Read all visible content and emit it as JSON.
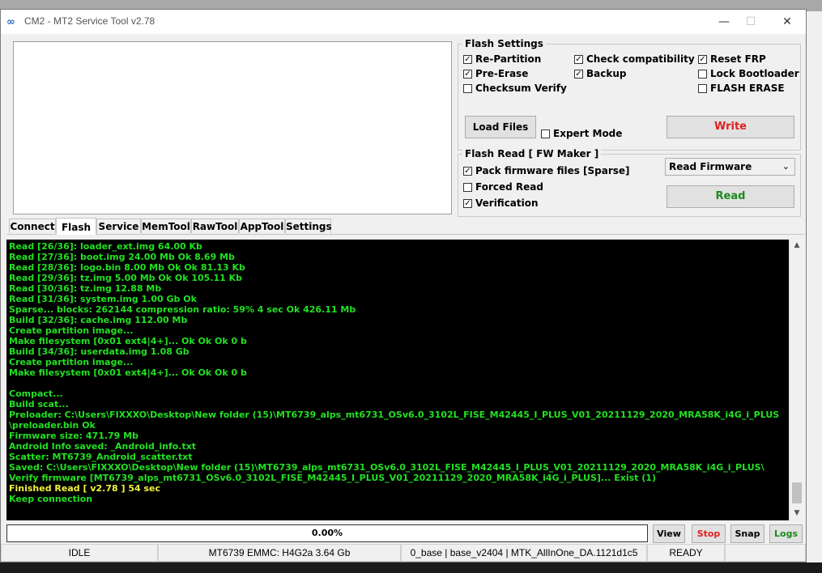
{
  "window": {
    "title": "CM2 - MT2 Service Tool v2.78",
    "icon": "mt2-app-icon",
    "controls": [
      "—",
      "☐",
      "✕"
    ]
  },
  "flash_settings": {
    "legend": "Flash Settings",
    "options": [
      {
        "label": "Re-Partition",
        "checked": true
      },
      {
        "label": "Check compatibility",
        "checked": true
      },
      {
        "label": "Reset FRP",
        "checked": true
      },
      {
        "label": "Pre-Erase",
        "checked": true
      },
      {
        "label": "Backup",
        "checked": true
      },
      {
        "label": "Lock Bootloader",
        "checked": false
      },
      {
        "label": "Checksum Verify",
        "checked": false
      },
      {
        "label": "FLASH ERASE",
        "checked": false
      }
    ],
    "load_files": "Load Files",
    "expert_mode": {
      "label": "Expert Mode",
      "checked": false
    },
    "write": "Write"
  },
  "flash_read": {
    "legend": "Flash Read [ FW Maker ]",
    "options": [
      {
        "label": "Pack firmware files [Sparse]",
        "checked": true
      },
      {
        "label": "Forced Read",
        "checked": false
      },
      {
        "label": "Verification",
        "checked": true
      }
    ],
    "mode_select": "Read Firmware",
    "read": "Read"
  },
  "tabs": [
    {
      "label": "Connect",
      "active": false
    },
    {
      "label": "Flash",
      "active": true
    },
    {
      "label": "Service",
      "active": false
    },
    {
      "label": "MemTool",
      "active": false
    },
    {
      "label": "RawTool",
      "active": false
    },
    {
      "label": "AppTool",
      "active": false
    },
    {
      "label": "Settings",
      "active": false
    }
  ],
  "log_lines": [
    "Read [26/36]: loader_ext.img 64.00 Kb",
    "Read [27/36]: boot.img 24.00 Mb Ok 8.69 Mb",
    "Read [28/36]: logo.bin 8.00 Mb Ok Ok 81.13 Kb",
    "Read [29/36]: tz.img 5.00 Mb Ok Ok 105.11 Kb",
    "Read [30/36]: tz.img 12.88 Mb",
    "Read [31/36]: system.img 1.00 Gb Ok",
    "Sparse... blocks: 262144 compression ratio: 59% 4 sec Ok 426.11 Mb",
    "Build [32/36]: cache.img 112.00 Mb",
    "Create partition image...",
    "Make filesystem [0x01 ext4|4+]... Ok Ok Ok 0 b",
    "Build [34/36]: userdata.img 1.08 Gb",
    "Create partition image...",
    "Make filesystem [0x01 ext4|4+]... Ok Ok Ok 0 b",
    "",
    "Compact...",
    "Build scat...",
    "Preloader: C:\\Users\\FIXXXO\\Desktop\\New folder (15)\\MT6739_alps_mt6731_OSv6.0_3102L_FISE_M42445_I_PLUS_V01_20211129_2020_MRA58K_i4G_i_PLUS",
    "\\preloader.bin Ok",
    "Firmware size: 471.79 Mb",
    "Android Info saved: _Android_info.txt",
    "Scatter: MT6739_Android_scatter.txt",
    "Saved: C:\\Users\\FIXXXO\\Desktop\\New folder (15)\\MT6739_alps_mt6731_OSv6.0_3102L_FISE_M42445_I_PLUS_V01_20211129_2020_MRA58K_i4G_i_PLUS\\",
    "Verify firmware [MT6739_alps_mt6731_OSv6.0_3102L_FISE_M42445_I_PLUS_V01_20211129_2020_MRA58K_i4G_i_PLUS]... Exist (1)",
    "Finished Read [ v2.78 ] 54 sec",
    "Keep connection"
  ],
  "log_highlight_line": "Finished Read [ v2.78 ] 54 sec",
  "progress": {
    "text": "0.00%",
    "value": 0
  },
  "buttons": {
    "view": "View",
    "stop": "Stop",
    "snap": "Snap",
    "logs": "Logs"
  },
  "status": {
    "state": "IDLE",
    "device": "MT6739 EMMC: H4G2a 3.64 Gb",
    "da": "0_base | base_v2404 | MTK_AllInOne_DA.1121d1c5",
    "ready": "READY"
  },
  "colors": {
    "log_bg": "#000000",
    "log_text": "#22e022",
    "log_highlight": "#f2f240",
    "write": "#e02020",
    "read": "#1a8a1a",
    "stop": "#e02020",
    "logs": "#1a8a1a"
  }
}
